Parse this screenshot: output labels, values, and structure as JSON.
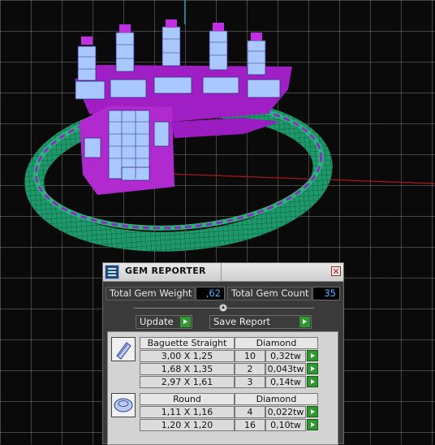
{
  "panel": {
    "title": "GEM REPORTER",
    "total_gem_weight_label": "Total Gem Weight",
    "total_gem_weight_value": ",62",
    "total_gem_count_label": "Total Gem Count",
    "total_gem_count_value": "35",
    "update_label": "Update",
    "save_report_label": "Save Report"
  },
  "groups": [
    {
      "icon": "baguette-gem-icon",
      "shape": "Baguette Straight",
      "material": "Diamond",
      "rows": [
        {
          "size": "3,00 X 1,25",
          "count": "10",
          "weight": "0,32tw"
        },
        {
          "size": "1,68 X 1,35",
          "count": "2",
          "weight": "0,043tw"
        },
        {
          "size": "2,97 X 1,61",
          "count": "3",
          "weight": "0,14tw"
        }
      ]
    },
    {
      "icon": "round-gem-icon",
      "shape": "Round",
      "material": "Diamond",
      "rows": [
        {
          "size": "1,11 X 1,16",
          "count": "4",
          "weight": "0,022tw"
        },
        {
          "size": "1,20 X 1,20",
          "count": "16",
          "weight": "0,10tw"
        }
      ]
    }
  ],
  "colors": {
    "viewport_bg": "#0a0a0a",
    "grid": "#9a9a9a",
    "ring_band": "#1e9a6a",
    "setting": "#b02ad0",
    "stone": "#a9c8ff",
    "accent_value": "#49b7ff",
    "go_green": "#2e9a2e"
  }
}
